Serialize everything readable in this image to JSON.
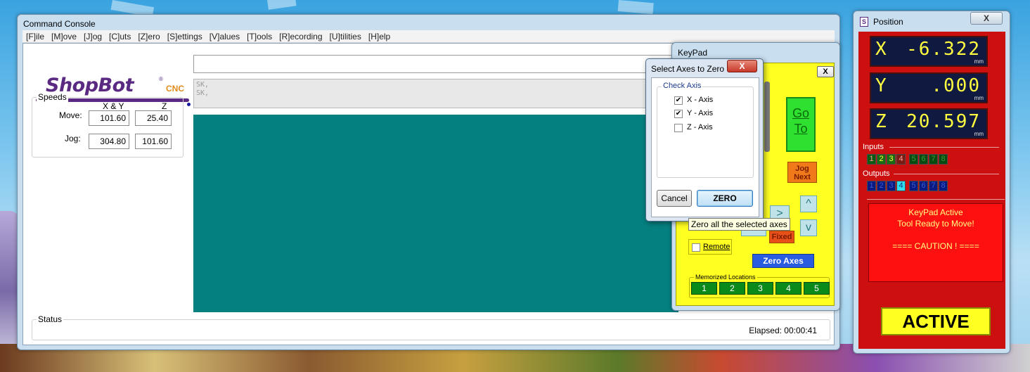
{
  "console": {
    "title": "Command Console",
    "menu": [
      "[F]ile",
      "[M]ove",
      "[J]og",
      "[C]uts",
      "[Z]ero",
      "[S]ettings",
      "[V]alues",
      "[T]ools",
      "[R]ecording",
      "[U]tilities",
      "[H]elp"
    ],
    "logo_text": "ShopBot",
    "logo_suffix": "CNC",
    "logo_reg": "®",
    "speeds": {
      "group_label": "Speeds",
      "col_xy": "X & Y",
      "col_z": "Z",
      "move_label": "Move:",
      "jog_label": "Jog:",
      "move_xy": "101.60",
      "move_z": "25.40",
      "jog_xy": "304.80",
      "jog_z": "101.60"
    },
    "history": [
      "SK,",
      "SK,"
    ],
    "status_label": "Status",
    "elapsed": "Elapsed: 00:00:41"
  },
  "keypad": {
    "title": "KeyPad",
    "close": "X",
    "goto_line1": "Go",
    "goto_line2": "To",
    "jog_next_line1": "Jog",
    "jog_next_line2": "Next",
    "arrow_right": ">",
    "arrow_up": "^",
    "arrow_down": "v",
    "fixed": "Fixed",
    "remote": "Remote",
    "zero_axes": "Zero Axes",
    "memorized_label": "Memorized Locations",
    "memorized": [
      "1",
      "2",
      "3",
      "4",
      "5"
    ]
  },
  "dialog": {
    "title": "Select Axes to Zero",
    "close": "X",
    "group_label": "Check Axis",
    "axes": [
      {
        "label": "X - Axis",
        "checked": true
      },
      {
        "label": "Y - Axis",
        "checked": true
      },
      {
        "label": "Z - Axis",
        "checked": false
      }
    ],
    "cancel": "Cancel",
    "zero": "ZERO",
    "tooltip": "Zero all the selected axes"
  },
  "position": {
    "title": "Position",
    "close": "X",
    "x_label": "X",
    "x_value": "-6.322",
    "y_label": "Y",
    "y_value": ".000",
    "z_label": "Z",
    "z_value": "20.597",
    "unit": "mm",
    "inputs_label": "Inputs",
    "inputs": [
      "1",
      "2",
      "3",
      "4",
      "5",
      "6",
      "7",
      "8"
    ],
    "outputs_label": "Outputs",
    "outputs": [
      "1",
      "2",
      "3",
      "4",
      "5",
      "6",
      "7",
      "8"
    ],
    "message_line1": "KeyPad Active",
    "message_line2": "Tool Ready to Move!",
    "message_line3": "==== CAUTION ! ====",
    "active": "ACTIVE"
  },
  "colors": {
    "teal": "#058080",
    "keypad_yellow": "#ffff22",
    "position_red": "#cc1010",
    "dro_text": "#ffff40"
  }
}
